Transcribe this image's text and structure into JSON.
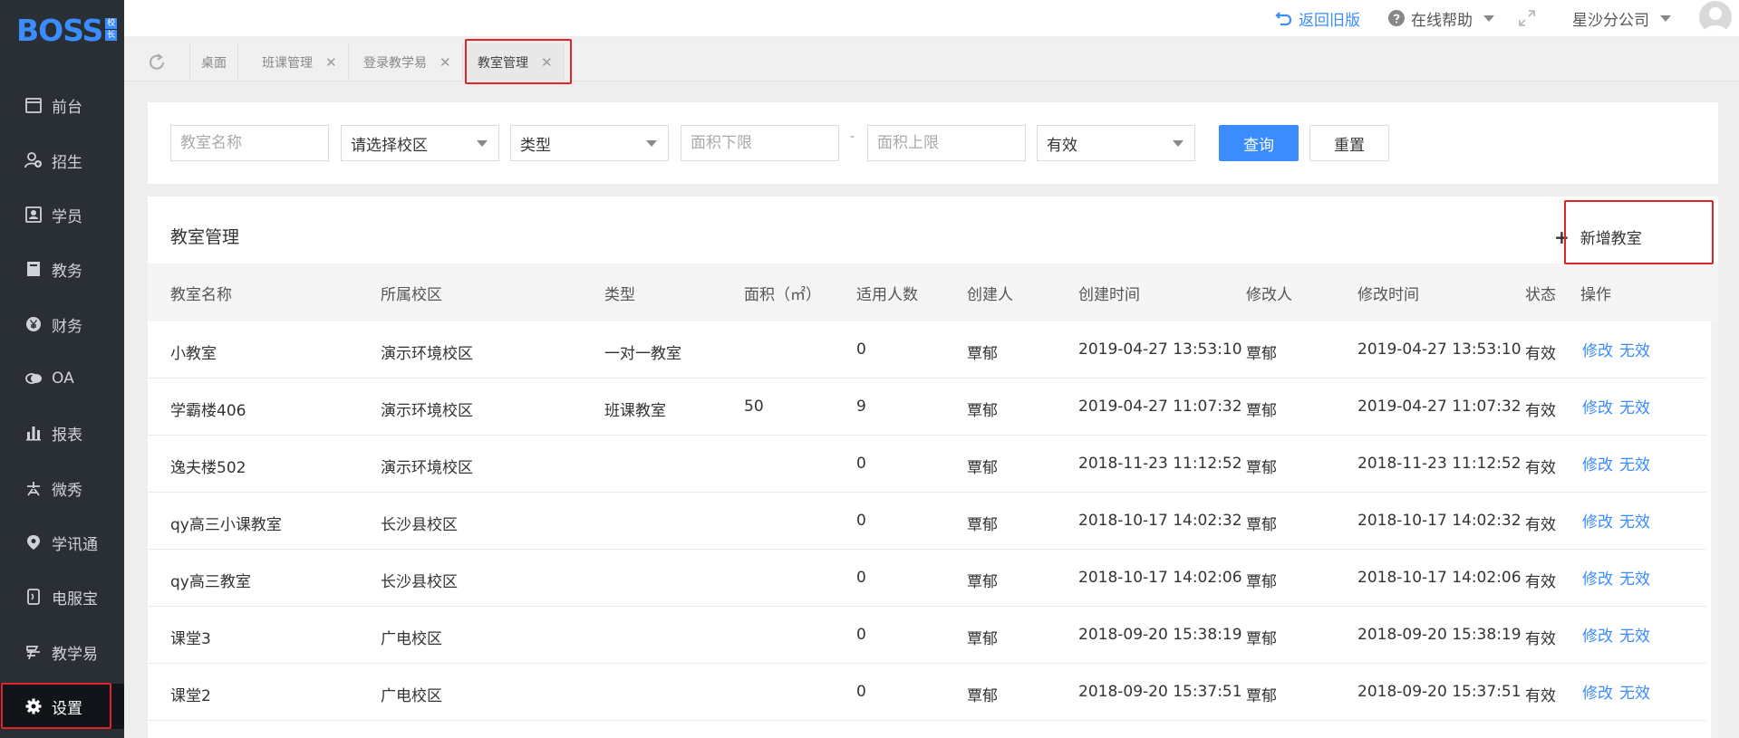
{
  "logo": {
    "text": "BOSS",
    "badge_top": "校",
    "badge_bottom": "长"
  },
  "sidebar": {
    "items": [
      {
        "label": "前台",
        "icon": "calendar-icon"
      },
      {
        "label": "招生",
        "icon": "add-user-icon"
      },
      {
        "label": "学员",
        "icon": "student-card-icon"
      },
      {
        "label": "教务",
        "icon": "book-icon"
      },
      {
        "label": "财务",
        "icon": "yen-icon"
      },
      {
        "label": "OA",
        "icon": "chat-icon"
      },
      {
        "label": "报表",
        "icon": "bar-chart-icon"
      },
      {
        "label": "微秀",
        "icon": "xiu-icon"
      },
      {
        "label": "学讯通",
        "icon": "location-pin-icon"
      },
      {
        "label": "电服宝",
        "icon": "phone-icon"
      },
      {
        "label": "教学易",
        "icon": "teaching-icon"
      },
      {
        "label": "设置",
        "icon": "gear-icon",
        "active": true
      }
    ]
  },
  "topbar": {
    "back_label": "返回旧版",
    "help_label": "在线帮助",
    "branch_label": "星沙分公司"
  },
  "tabs": [
    {
      "label": "桌面",
      "closable": false
    },
    {
      "label": "班课管理",
      "closable": true
    },
    {
      "label": "登录教学易",
      "closable": true
    },
    {
      "label": "教室管理",
      "closable": true,
      "active": true
    }
  ],
  "filters": {
    "name_placeholder": "教室名称",
    "campus_value": "请选择校区",
    "type_value": "类型",
    "area_min_placeholder": "面积下限",
    "range_sep": "-",
    "area_max_placeholder": "面积上限",
    "status_value": "有效",
    "query_label": "查询",
    "reset_label": "重置"
  },
  "table": {
    "title": "教室管理",
    "add_label": "新增教室",
    "columns": [
      "教室名称",
      "所属校区",
      "类型",
      "面积（㎡）",
      "适用人数",
      "创建人",
      "创建时间",
      "修改人",
      "修改时间",
      "状态",
      "操作"
    ],
    "edit_label": "修改",
    "invalid_label": "无效",
    "rows": [
      [
        "小教室",
        "演示环境校区",
        "一对一教室",
        "",
        "0",
        "覃郁",
        "2019-04-27 13:53:10",
        "覃郁",
        "2019-04-27 13:53:10",
        "有效"
      ],
      [
        "学霸楼406",
        "演示环境校区",
        "班课教室",
        "50",
        "9",
        "覃郁",
        "2019-04-27 11:07:32",
        "覃郁",
        "2019-04-27 11:07:32",
        "有效"
      ],
      [
        "逸夫楼502",
        "演示环境校区",
        "",
        "",
        "0",
        "覃郁",
        "2018-11-23 11:12:52",
        "覃郁",
        "2018-11-23 11:12:52",
        "有效"
      ],
      [
        "qy高三小课教室",
        "长沙县校区",
        "",
        "",
        "0",
        "覃郁",
        "2018-10-17 14:02:32",
        "覃郁",
        "2018-10-17 14:02:32",
        "有效"
      ],
      [
        "qy高三教室",
        "长沙县校区",
        "",
        "",
        "0",
        "覃郁",
        "2018-10-17 14:02:06",
        "覃郁",
        "2018-10-17 14:02:06",
        "有效"
      ],
      [
        "课堂3",
        "广电校区",
        "",
        "",
        "0",
        "覃郁",
        "2018-09-20 15:38:19",
        "覃郁",
        "2018-09-20 15:38:19",
        "有效"
      ],
      [
        "课堂2",
        "广电校区",
        "",
        "",
        "0",
        "覃郁",
        "2018-09-20 15:37:51",
        "覃郁",
        "2018-09-20 15:37:51",
        "有效"
      ]
    ]
  },
  "colors": {
    "accent": "#3b8cff",
    "sidebar_bg": "#2a2f36",
    "highlight": "#e0242b"
  }
}
